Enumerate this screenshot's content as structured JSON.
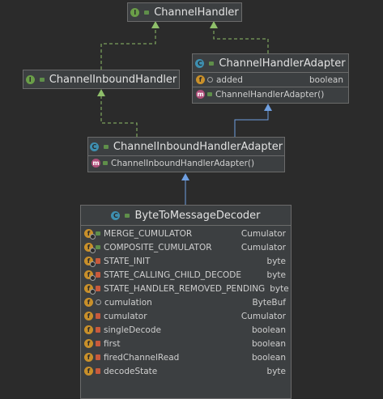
{
  "classes": {
    "channel_handler": {
      "name": "ChannelHandler"
    },
    "channel_inbound_handler": {
      "name": "ChannelInboundHandler"
    },
    "channel_handler_adapter": {
      "name": "ChannelHandlerAdapter",
      "fields": [
        {
          "name": "added",
          "type": "boolean"
        }
      ],
      "methods": [
        {
          "name": "ChannelHandlerAdapter()"
        }
      ]
    },
    "channel_inbound_handler_adapter": {
      "name": "ChannelInboundHandlerAdapter",
      "methods": [
        {
          "name": "ChannelInboundHandlerAdapter()"
        }
      ]
    },
    "byte_to_message_decoder": {
      "name": "ByteToMessageDecoder",
      "fields": [
        {
          "name": "MERGE_CUMULATOR",
          "type": "Cumulator"
        },
        {
          "name": "COMPOSITE_CUMULATOR",
          "type": "Cumulator"
        },
        {
          "name": "STATE_INIT",
          "type": "byte"
        },
        {
          "name": "STATE_CALLING_CHILD_DECODE",
          "type": "byte"
        },
        {
          "name": "STATE_HANDLER_REMOVED_PENDING",
          "type": "byte"
        },
        {
          "name": "cumulation",
          "type": "ByteBuf"
        },
        {
          "name": "cumulator",
          "type": "Cumulator"
        },
        {
          "name": "singleDecode",
          "type": "boolean"
        },
        {
          "name": "first",
          "type": "boolean"
        },
        {
          "name": "firedChannelRead",
          "type": "boolean"
        },
        {
          "name": "decodeState",
          "type": "byte"
        }
      ]
    }
  },
  "icons": {
    "interface": "interface-icon",
    "class": "class-icon",
    "abstract_class": "abstract-class-icon",
    "field": "field-icon",
    "method": "method-icon"
  },
  "colors": {
    "background": "#2b2b2b",
    "box": "#3c3f41",
    "border": "#6b6b6b",
    "implements_edge": "#8fbf6a",
    "extends_edge": "#6f9fe0"
  }
}
